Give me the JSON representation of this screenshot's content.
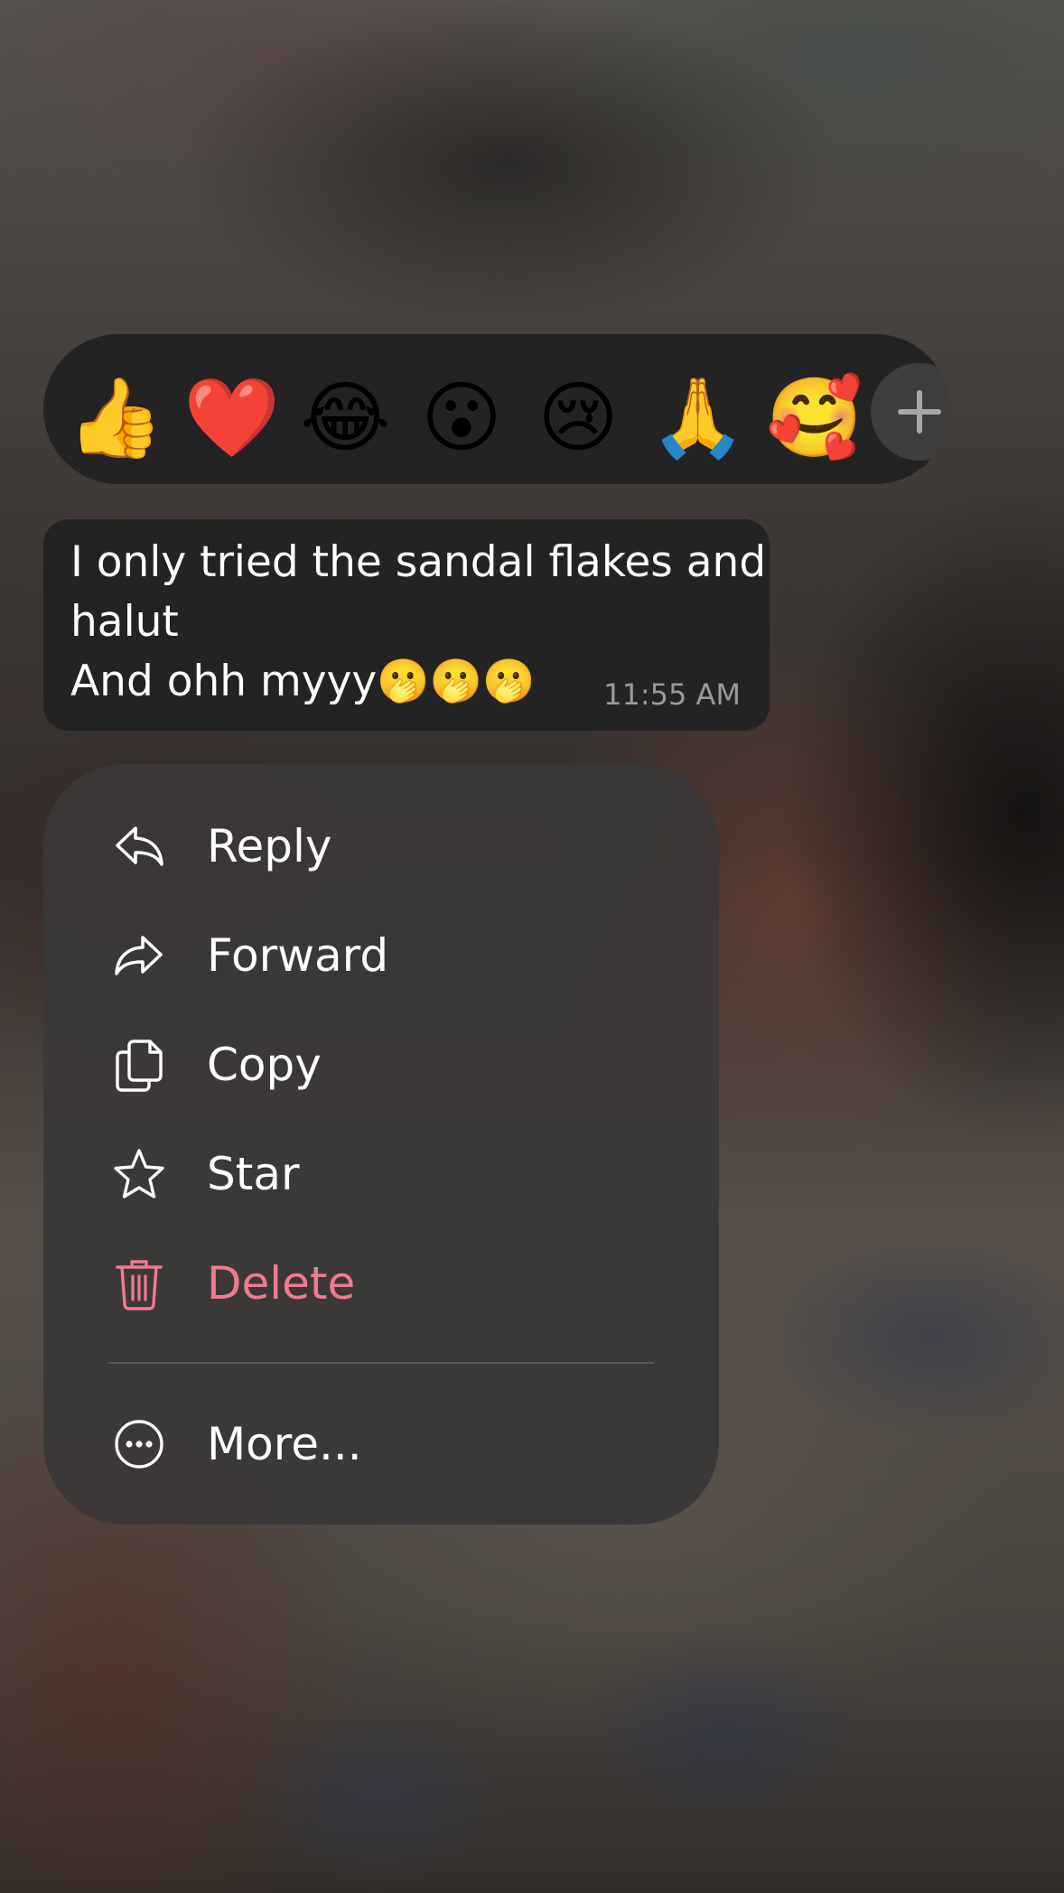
{
  "reactions": {
    "items": [
      {
        "emoji": "👍",
        "name": "thumbs-up"
      },
      {
        "emoji": "❤️",
        "name": "red-heart"
      },
      {
        "emoji": "😂",
        "name": "tears-of-joy"
      },
      {
        "emoji": "😮",
        "name": "open-mouth"
      },
      {
        "emoji": "😢",
        "name": "crying-face"
      },
      {
        "emoji": "🙏",
        "name": "folded-hands"
      },
      {
        "emoji": "🥰",
        "name": "smiling-hearts"
      }
    ],
    "more_icon": "plus-icon"
  },
  "message": {
    "line1": "I only tried the sandal flakes and",
    "line2": "halut",
    "line3": "And ohh myyy🫢🫢🫢",
    "time": "11:55 AM"
  },
  "menu": {
    "reply": "Reply",
    "forward": "Forward",
    "copy": "Copy",
    "star": "Star",
    "delete": "Delete",
    "more": "More..."
  },
  "colors": {
    "surface": "#232323",
    "menu_bg": "#3a3837",
    "danger": "#f07a8e",
    "timestamp": "#9a9a9a"
  }
}
